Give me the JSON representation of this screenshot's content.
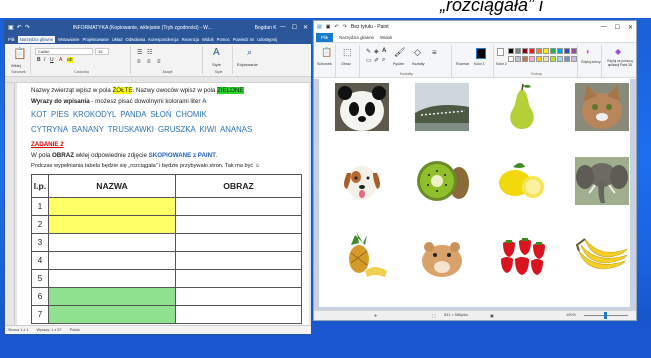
{
  "banner": {
    "text": "„rozciągała” i"
  },
  "word": {
    "title": "INFORMATYKA (Kopiowanie, wklejanie (Tryb zgodności) - W...",
    "user": "Bogdan K",
    "tabs": [
      "Plik",
      "Narzędzia główne",
      "Wstawianie",
      "Projektowanie",
      "Układ",
      "Odwołania",
      "Korespondencja",
      "Recenzja",
      "Widok",
      "Pomoc",
      "Powiedz mi",
      "Udostępnij"
    ],
    "ribbon": {
      "paste": "Wklej",
      "font": "Calibri",
      "size": "16",
      "styles": "Style",
      "editing": "Edytowanie",
      "groups": [
        "Schowek",
        "Czcionka",
        "Akapit",
        "Style",
        "Edytowanie"
      ]
    },
    "doc": {
      "line1_a": "Nazwy zwierząt wpisz w pola ",
      "line1_hl1": "ŻÓŁTE",
      "line1_b": ". Nazwy owoców wpisz w pola ",
      "line1_hl2": "ZIELONE",
      "line2_a": "Wyrazy do wpisania",
      "line2_b": " - możesz pisać dowolnymi kolorami liter",
      "words1": "KOT  PIES  KROKODYL  PANDA  SŁOŃ  CHOMIK",
      "words2": "CYTRYNA  BANANY  TRUSKAWKI  GRUSZKA  KIWI  ANANAS",
      "task": "ZADANIE 2",
      "line3_a": "W pola ",
      "line3_b": "OBRAZ",
      "line3_c": " wklej odpowiednie zdjęcie ",
      "line3_d": "SKOPIOWANE z PAINT",
      "line3_e": ".",
      "line4": "Podczas wypełniania tabela będzie się „rozciągała” i będzie przybywało stron. Tak ma być ☺",
      "table_headers": [
        "l.p.",
        "NAZWA",
        "OBRAZ"
      ],
      "rows": [
        "1",
        "2",
        "3",
        "4",
        "5",
        "6",
        "7"
      ]
    },
    "status": {
      "page": "Strona 1 z 1",
      "words": "Wyrazy: 1 z 57",
      "lang": "Polski"
    }
  },
  "paint": {
    "title": "Bez tytułu - Paint",
    "tabs": [
      "Plik",
      "Narzędzia główne",
      "Widok"
    ],
    "ribbon": {
      "clipboard": "Schowek",
      "image": "Obraz",
      "brushes": "Pędzle",
      "shapes": "Kształty",
      "outline": "Rozmiar",
      "color1": "Kolor 1",
      "color2": "Kolor 2",
      "edit": "Edytuj kolory",
      "paint3d": "Edytuj za pomocą aplikacji Paint 3D",
      "groups": [
        "Schowek",
        "Obraz",
        "Narzędzia",
        "Kształty",
        "Kolory"
      ]
    },
    "palette": [
      "#000000",
      "#7f7f7f",
      "#880015",
      "#ed1c24",
      "#ff7f27",
      "#fff200",
      "#22b14c",
      "#00a2e8",
      "#3f48cc",
      "#a349a4",
      "#ffffff",
      "#c3c3c3",
      "#b97a57",
      "#ffaec9",
      "#ffc90e",
      "#efe4b0",
      "#b5e61d",
      "#99d9ea",
      "#7092be",
      "#c8bfe7"
    ],
    "images": [
      "panda",
      "crocodile",
      "pear",
      "cat",
      "dog",
      "kiwi",
      "lemon",
      "elephant",
      "pineapple",
      "hamster",
      "strawberries",
      "bananas"
    ],
    "status": {
      "size": "831 × 586piks.",
      "zoom": "100%"
    }
  }
}
